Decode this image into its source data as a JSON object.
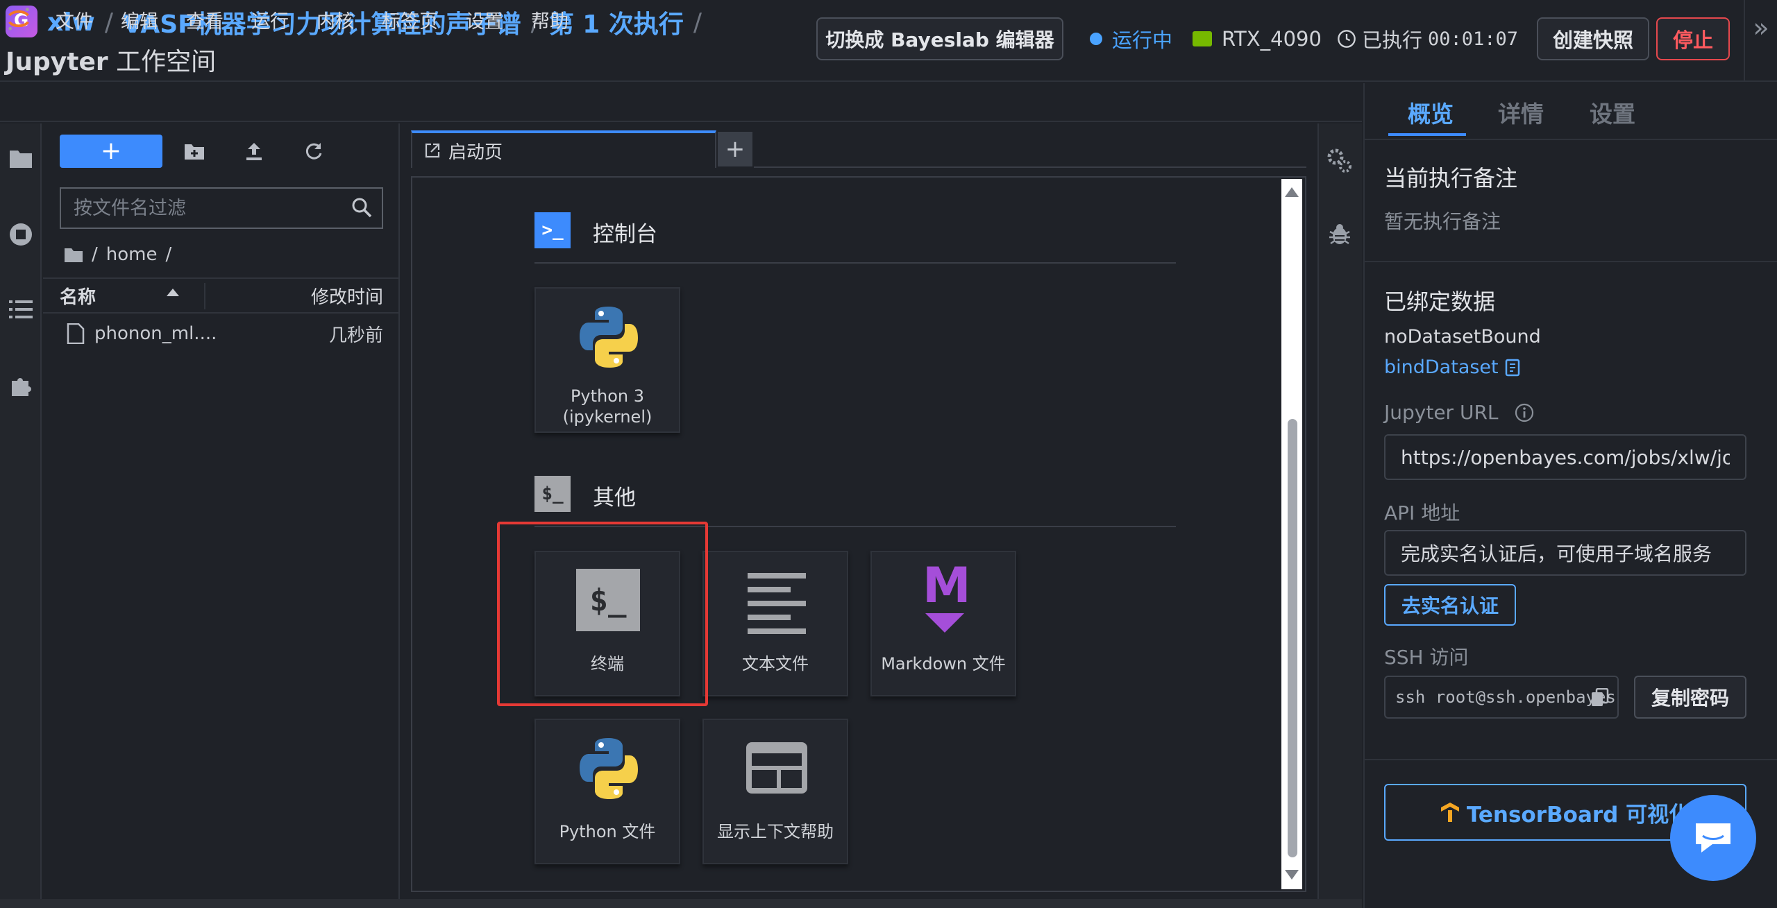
{
  "header": {
    "breadcrumbs": [
      "xlw",
      "VASP机器学习力场计算硅的声子谱",
      "第 1 次执行"
    ],
    "separator": "/",
    "workspace_bold": "Jupyter",
    "workspace_rest": " 工作空间",
    "switch_editor_label": "切换成 Bayeslab 编辑器",
    "status_text": "运行中",
    "gpu_name": "RTX_4090",
    "executed_label": "已执行",
    "executed_time": "00:01:07",
    "snapshot_label": "创建快照",
    "stop_label": "停止",
    "colors": {
      "accent": "#3d8bfd",
      "link": "#5aa9ff",
      "danger": "#e5484d",
      "nvidia": "#76b900"
    }
  },
  "menubar": {
    "items": [
      "文件",
      "编辑",
      "查看",
      "运行",
      "内核",
      "标签页",
      "设置",
      "帮助"
    ]
  },
  "filebrowser": {
    "new_label": "+",
    "filter_placeholder": "按文件名过滤",
    "path_parts": [
      "/",
      "home",
      "/"
    ],
    "col_name": "名称",
    "col_modified": "修改时间",
    "files": [
      {
        "name": "phonon_ml....",
        "modified": "几秒前"
      }
    ]
  },
  "dock": {
    "tab_label": "启动页",
    "add_tab": "+"
  },
  "launcher": {
    "section_console": "控制台",
    "console_icon_text": ">_",
    "console_kernel": {
      "line1": "Python 3",
      "line2": "(ipykernel)"
    },
    "section_other": "其他",
    "other_icon_text": "$_",
    "terminal_icon_text": "$_",
    "markdown_icon_text": "M",
    "other_cards": [
      "终端",
      "文本文件",
      "Markdown 文件",
      "Python 文件",
      "显示上下文帮助"
    ]
  },
  "rpanel": {
    "tabs": [
      "概览",
      "详情",
      "设置"
    ],
    "note_title": "当前执行备注",
    "note_empty": "暂无执行备注",
    "dataset_title": "已绑定数据",
    "dataset_value": "noDatasetBound",
    "dataset_link": "bindDataset",
    "jupyter_url_label": "Jupyter URL",
    "jupyter_url_value": "https://openbayes.com/jobs/xlw/jobs/",
    "api_label": "API 地址",
    "api_value": "完成实名认证后，可使用子域名服务",
    "verify_label": "去实名认证",
    "ssh_label": "SSH 访问",
    "ssh_value": "ssh root@ssh.openbayes.com",
    "copy_password_label": "复制密码",
    "tensorboard_label": "TensorBoard 可视化"
  }
}
